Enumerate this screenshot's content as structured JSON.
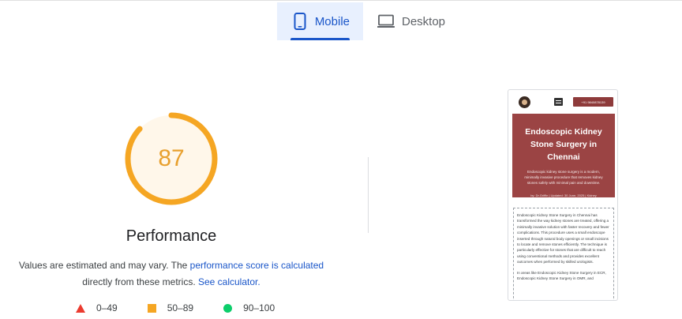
{
  "tabs": [
    {
      "label": "Mobile",
      "icon": "smartphone-icon",
      "active": true
    },
    {
      "label": "Desktop",
      "icon": "monitor-icon",
      "active": false
    }
  ],
  "performance": {
    "score": 87,
    "score_text": "87",
    "title": "Performance",
    "desc_prefix": "Values are estimated and may vary. The ",
    "desc_link1": "performance score is calculated",
    "desc_middle": "directly from these metrics. ",
    "desc_link2": "See calculator.",
    "gauge_color": "#f5a623",
    "gauge_bg": "#fff7ea"
  },
  "legend": [
    {
      "range": "0–49",
      "shape": "triangle",
      "color": "#eb3b2f"
    },
    {
      "range": "50–89",
      "shape": "square",
      "color": "#f5a623"
    },
    {
      "range": "90–100",
      "shape": "circle",
      "color": "#0cce6b"
    }
  ],
  "preview": {
    "call_label": "+91 9840878139",
    "hero_title": "Endoscopic Kidney Stone Surgery in Chennai",
    "hero_sub": "Endoscopic kidney stone surgery is a modern, minimally invasive procedure that removes kidney stones safely with minimal pain and downtime.",
    "hero_meta": "by: Dr.Griffin  |  Updated: 30 June, 2025  |  Kidney",
    "body_p1": "Endoscopic Kidney Stone Surgery in Chennai has transformed the way kidney stones are treated, offering a minimally invasive solution with faster recovery and fewer complications. This procedure uses a small endoscope inserted through natural body openings or small incisions to locate and remove stones efficiently. The technique is particularly effective for stones that are difficult to reach using conventional methods and provides excellent outcomes when performed by skilled urologists.",
    "body_p2": "In areas like Endoscopic Kidney Stone Surgery in ECR, Endoscopic Kidney Stone Surgery in OMR, and"
  }
}
